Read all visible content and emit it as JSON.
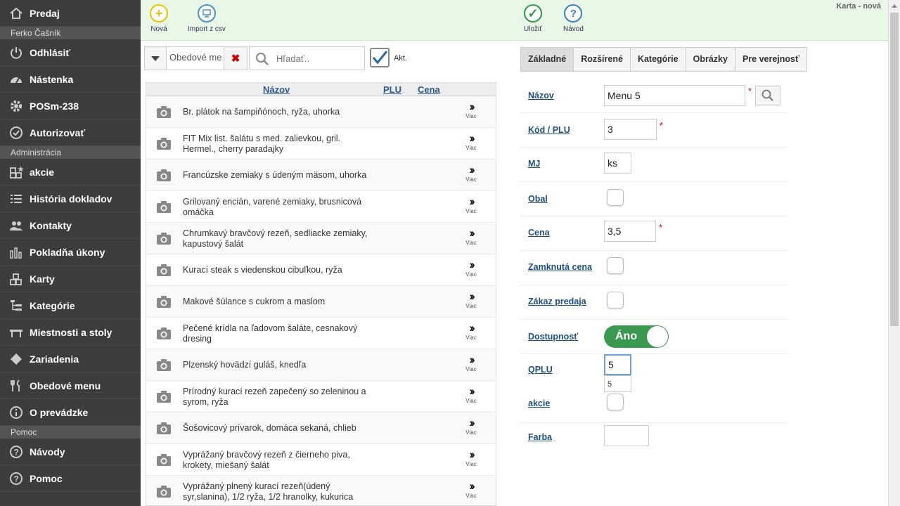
{
  "sidebar": {
    "items": [
      {
        "name": "sidebar-item-predaj",
        "icon": "home-icon",
        "label": "Predaj"
      },
      {
        "section": "Ferko Čašník"
      },
      {
        "name": "sidebar-item-odhlasit",
        "icon": "power-icon",
        "label": "Odhlásiť"
      },
      {
        "name": "sidebar-item-nastenka",
        "icon": "dashboard-icon",
        "label": "Nástenka"
      },
      {
        "name": "sidebar-item-posm",
        "icon": "gear-icon",
        "label": "POSm-238"
      },
      {
        "name": "sidebar-item-autorizovat",
        "icon": "check-circle-icon",
        "label": "Autorizovať"
      },
      {
        "section": "Administrácia"
      },
      {
        "name": "sidebar-item-akcie",
        "icon": "boxes-star-icon",
        "label": "akcie"
      },
      {
        "name": "sidebar-item-historia",
        "icon": "list-icon",
        "label": "História dokladov"
      },
      {
        "name": "sidebar-item-kontakty",
        "icon": "users-icon",
        "label": "Kontakty"
      },
      {
        "name": "sidebar-item-pokladna",
        "icon": "bar-chart-icon",
        "label": "Pokladňa úkony"
      },
      {
        "name": "sidebar-item-karty",
        "icon": "boxes-icon",
        "label": "Karty"
      },
      {
        "name": "sidebar-item-kategorie",
        "icon": "tree-icon",
        "label": "Kategórie"
      },
      {
        "name": "sidebar-item-miestnosti",
        "icon": "table-icon",
        "label": "Miestnosti a stoly"
      },
      {
        "name": "sidebar-item-zariadenia",
        "icon": "diamond-icon",
        "label": "Zariadenia"
      },
      {
        "name": "sidebar-item-obedove",
        "icon": "cutlery-icon",
        "label": "Obedové menu"
      },
      {
        "name": "sidebar-item-oprevadzke",
        "icon": "info-icon",
        "label": "O prevádzke"
      },
      {
        "section": "Pomoc"
      },
      {
        "name": "sidebar-item-navody",
        "icon": "question-icon",
        "label": "Návody"
      },
      {
        "name": "sidebar-item-pomoc",
        "icon": "question-icon",
        "label": "Pomoc"
      }
    ]
  },
  "toolbar": {
    "new_label": "Nová",
    "import_label": "Import z csv",
    "save_label": "Uložiť",
    "guide_label": "Návod",
    "karta_label": "Karta - nová",
    "colors": {
      "new": "#e8c400",
      "import": "#4a90c0",
      "save": "#2e9a4a",
      "guide": "#3a80c0"
    }
  },
  "filter": {
    "dropdown_value": "Obedové me",
    "search_placeholder": "Hľadať..",
    "akt_label": "Akt."
  },
  "list": {
    "headers": {
      "name": "Názov",
      "plu": "PLU",
      "price": "Cena"
    },
    "more_label": "Viac",
    "rows": [
      "Br. plátok na šampiňónoch, ryža, uhorka",
      "FIT Mix list. šalátu s med. zalievkou, gril. Hermel., cherry paradajky",
      "Francúzske zemiaky s údeným mäsom, uhorka",
      "Grilovaný encián, varené zemiaky, brusnicová omáčka",
      "Chrumkavý bravčový rezeň, sedliacke zemiaky, kapustový šalát",
      "Kurací steak s viedenskou cibuľkou, ryža",
      "Makové šúlance s cukrom a maslom",
      "Pečené krídla na ľadovom šaláte, cesnakový dresing",
      "Plzenský hovädzí guláš, knedľa",
      "Prírodný kurací rezeň zapečený so zeleninou a syrom, ryža",
      "Šošovicový prívarok, domáca sekaná, chlieb",
      "Vyprážaný bravčový rezeň z čierneho piva, krokety, miešaný šalát",
      "Vyprážaný plnený kurací rezeň(údený syr,slanina), 1/2 ryža, 1/2 hranolky, kukurica"
    ]
  },
  "tabs": [
    "Základné",
    "Rozšírené",
    "Kategórie",
    "Obrázky",
    "Pre verejnosť"
  ],
  "form": {
    "nazov": {
      "label": "Názov",
      "value": "Menu 5"
    },
    "kod": {
      "label": "Kód / PLU",
      "value": "3"
    },
    "mj": {
      "label": "MJ",
      "value": "ks"
    },
    "obal": {
      "label": "Obal"
    },
    "cena": {
      "label": "Cena",
      "value": "3,5"
    },
    "zamknuta": {
      "label": "Zamknutá cena"
    },
    "zakaz": {
      "label": "Zákaz predaja"
    },
    "dostupnost": {
      "label": "Dostupnosť",
      "value": "Áno"
    },
    "qplu": {
      "label": "QPLU",
      "value": "5",
      "suggestion": "5"
    },
    "akcie": {
      "label": "akcie"
    },
    "farba": {
      "label": "Farba",
      "value": ""
    },
    "required_mark": "*"
  }
}
